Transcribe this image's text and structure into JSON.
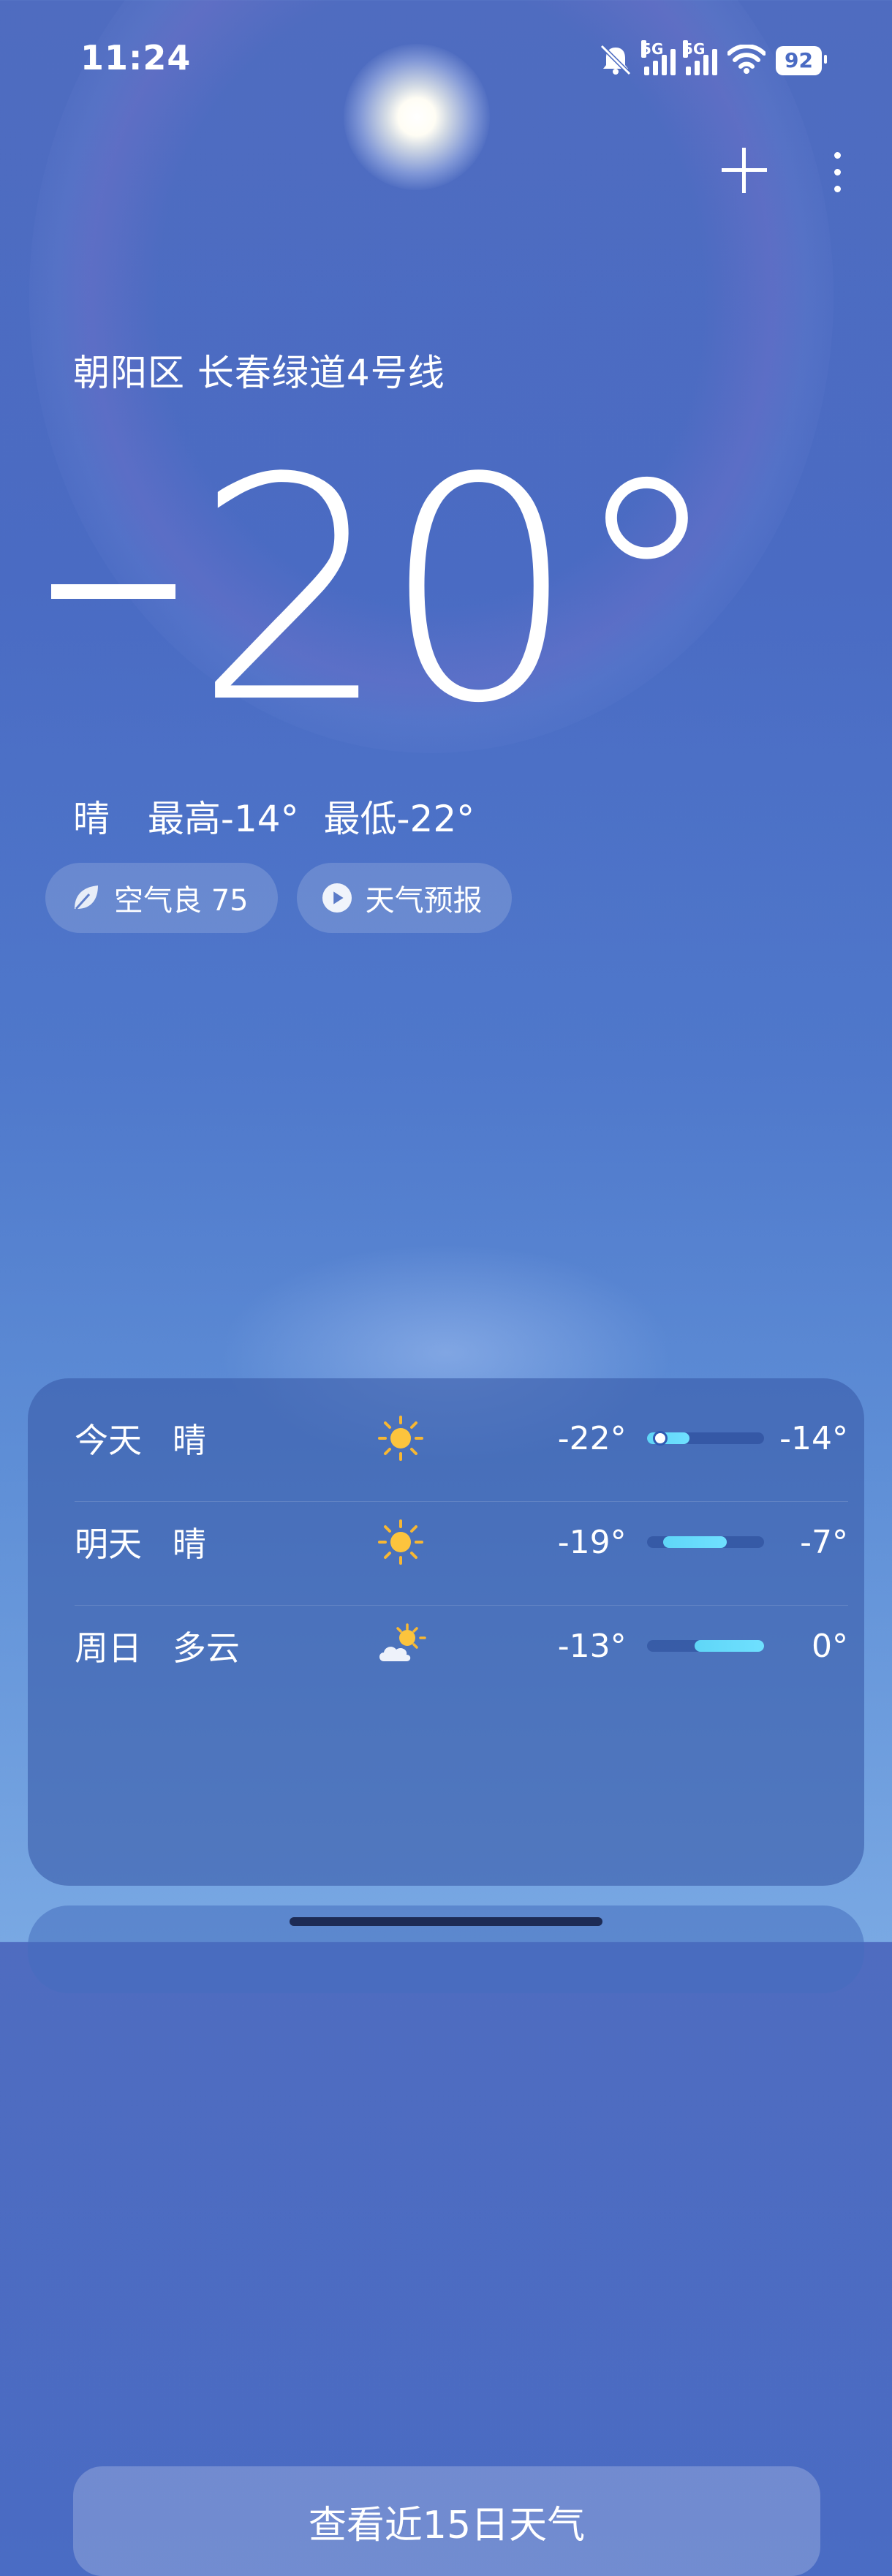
{
  "status_bar": {
    "time": "11:24",
    "network_1": "5G",
    "network_2": "5G",
    "battery": "92"
  },
  "header": {
    "add_icon": "plus-icon",
    "menu_icon": "more-vertical-icon"
  },
  "current": {
    "location": "朝阳区 长春绿道4号线",
    "temperature": "20°",
    "temperature_sign": "−",
    "condition": "晴",
    "high": "最高-14°",
    "low": "最低-22°"
  },
  "chips": {
    "air_quality": "空气良 75",
    "forecast_video": "天气预报"
  },
  "forecast": [
    {
      "day": "今天",
      "condition": "晴",
      "icon": "sun-icon",
      "low": "-22°",
      "high": "-14°",
      "low_value": -22,
      "high_value": -14,
      "current_value": -20
    },
    {
      "day": "明天",
      "condition": "晴",
      "icon": "sun-icon",
      "low": "-19°",
      "high": "-7°",
      "low_value": -19,
      "high_value": -7
    },
    {
      "day": "周日",
      "condition": "多云",
      "icon": "partly-cloudy-icon",
      "low": "-13°",
      "high": "0°",
      "low_value": -13,
      "high_value": 0
    }
  ],
  "forecast_button": "查看近15日天气",
  "colors": {
    "background_top": "#4f6cc0",
    "background_bottom": "#79a8e3",
    "range_fill": "#5fd6f7",
    "sun": "#f7b733"
  }
}
